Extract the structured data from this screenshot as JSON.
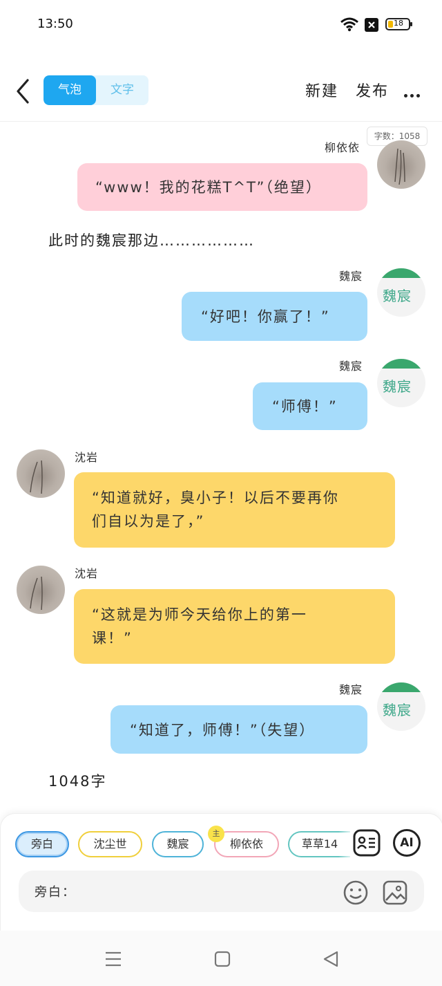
{
  "status_bar": {
    "time": "13:50",
    "battery": "18",
    "icons": [
      "wifi-icon",
      "sim-off-icon",
      "battery-icon"
    ]
  },
  "header": {
    "tabs": [
      {
        "label": "气泡",
        "active": true
      },
      {
        "label": "文字",
        "active": false
      }
    ],
    "new_label": "新建",
    "publish_label": "发布",
    "icons": [
      "back-arrow-icon",
      "more-icon"
    ]
  },
  "word_count_badge": "字数：1058",
  "messages": [
    {
      "type": "bubble",
      "speaker": "柳依依",
      "side": "right",
      "color": "pink",
      "text": "“www！我的花糕T^T”（绝望）"
    },
    {
      "type": "narration",
      "text": "此时的魏宸那边………………"
    },
    {
      "type": "bubble",
      "speaker": "魏宸",
      "side": "right",
      "color": "blue",
      "text": "“好吧！你赢了！”",
      "avatar_text": "魏宸"
    },
    {
      "type": "bubble",
      "speaker": "魏宸",
      "side": "right",
      "color": "blue",
      "text": "“师傅！”",
      "avatar_text": "魏宸"
    },
    {
      "type": "bubble",
      "speaker": "沈岩",
      "side": "left",
      "color": "yellow",
      "lines": [
        "“知道就好，臭小子！以后不要再你",
        "们自以为是了，”"
      ]
    },
    {
      "type": "bubble",
      "speaker": "沈岩",
      "side": "left",
      "color": "yellow",
      "lines": [
        "“这就是为师今天给你上的第一",
        "课！”"
      ]
    },
    {
      "type": "bubble",
      "speaker": "魏宸",
      "side": "right",
      "color": "blue",
      "text": "“知道了，师傅！”（失望）",
      "avatar_text": "魏宸"
    },
    {
      "type": "narration",
      "text": "1048字"
    }
  ],
  "characters": [
    {
      "label": "旁白",
      "selected": true
    },
    {
      "label": "沈尘世",
      "selected": false
    },
    {
      "label": "魏宸",
      "selected": false
    },
    {
      "label": "柳依依",
      "selected": false,
      "badge": "主"
    },
    {
      "label": "草草14",
      "selected": false
    }
  ],
  "tools": {
    "ai_label": "AI",
    "icons": [
      "character-card-icon",
      "emoji-icon",
      "image-icon"
    ]
  },
  "input": {
    "prefix": "旁白："
  },
  "nav": {
    "icons": [
      "menu-icon",
      "home-icon",
      "back-icon"
    ]
  },
  "colors": {
    "accent_blue": "#1ea7f0",
    "bubble_pink": "#ffcfd9",
    "bubble_blue": "#a6dcfb",
    "bubble_yellow": "#fdd76a"
  }
}
